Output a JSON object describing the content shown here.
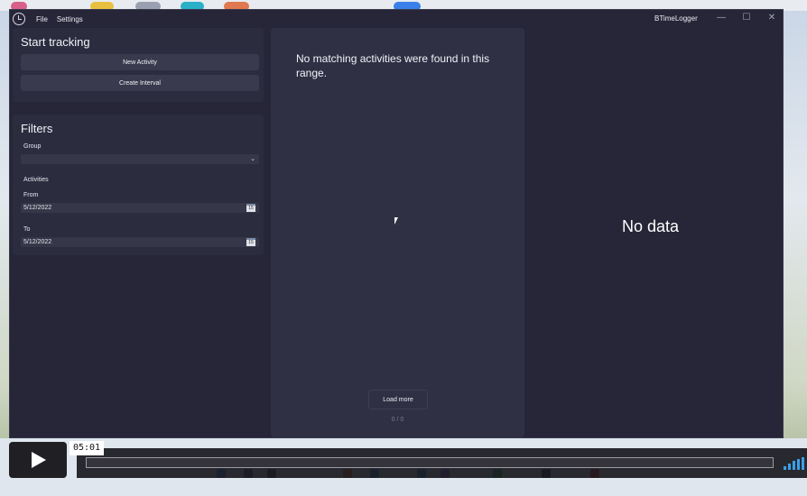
{
  "window": {
    "app_title": "BTimeLogger",
    "menu": [
      "File",
      "Settings"
    ],
    "controls": {
      "minimize": "—",
      "maximize": "☐",
      "close": "✕"
    }
  },
  "start_tracking": {
    "title": "Start tracking",
    "new_activity_label": "New Activity",
    "create_interval_label": "Create Interval"
  },
  "filters": {
    "title": "Filters",
    "group_label": "Group",
    "group_value": "",
    "activities_label": "Activities",
    "from_label": "From",
    "from_value": "5/12/2022",
    "to_label": "To",
    "to_value": "5/12/2022",
    "calendar_icon_text": "15"
  },
  "activity_list": {
    "empty_message": "No matching activities were found in this range.",
    "load_more_label": "Load more",
    "page_count": "0 / 0"
  },
  "chart_area": {
    "empty_message": "No data"
  },
  "video_player": {
    "current_time": "05:01"
  },
  "icons": {
    "app": "clock-icon",
    "dropdown": "chevron-down-icon",
    "calendar": "calendar-icon",
    "play": "play-icon",
    "volume": "volume-icon"
  }
}
